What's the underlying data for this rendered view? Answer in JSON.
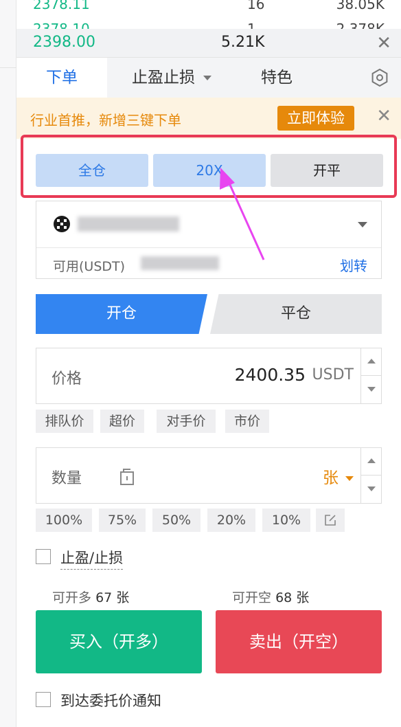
{
  "orderbook": {
    "rows": [
      {
        "price": "2378.11",
        "qty": "16",
        "total": "38.05K"
      },
      {
        "price": "2378.10",
        "qty": "1",
        "total": "2.378K"
      }
    ],
    "last_price": "2398.00",
    "volume": "5.21K",
    "close_glyph": "✕"
  },
  "tabs": {
    "order": "下单",
    "tp_sl": "止盈止损",
    "special": "特色",
    "settings_icon": "gear-icon"
  },
  "banner": {
    "text": "行业首推，新增三键下单",
    "cta": "立即体验",
    "close_glyph": "✕"
  },
  "mode": {
    "margin": "全仓",
    "leverage": "20X",
    "position_mode": "开平"
  },
  "account": {
    "available_label": "可用(USDT)",
    "transfer": "划转"
  },
  "open_close": {
    "open": "开仓",
    "close": "平仓"
  },
  "price": {
    "label": "价格",
    "value": "2400.35",
    "unit": "USDT",
    "chips": [
      "排队价",
      "超价",
      "对手价",
      "市价"
    ]
  },
  "quantity": {
    "label": "数量",
    "unit": "张",
    "chips": [
      "100%",
      "75%",
      "50%",
      "20%",
      "10%"
    ]
  },
  "tp_sl_checkbox": {
    "label": "止盈/止损",
    "checked": false
  },
  "available": {
    "long_label": "可开多",
    "long_value": "67 张",
    "short_label": "可开空",
    "short_value": "68 张"
  },
  "buttons": {
    "buy": "买入（开多）",
    "sell": "卖出（开空）"
  },
  "notify_checkbox": {
    "label": "到达委托价通知",
    "checked": false
  },
  "colors": {
    "buy": "#12b886",
    "sell": "#e84856",
    "accent": "#1f6fe5",
    "warning": "#e6890b",
    "highlight_box": "#e83a55",
    "annotation_arrow": "#e845f0"
  }
}
